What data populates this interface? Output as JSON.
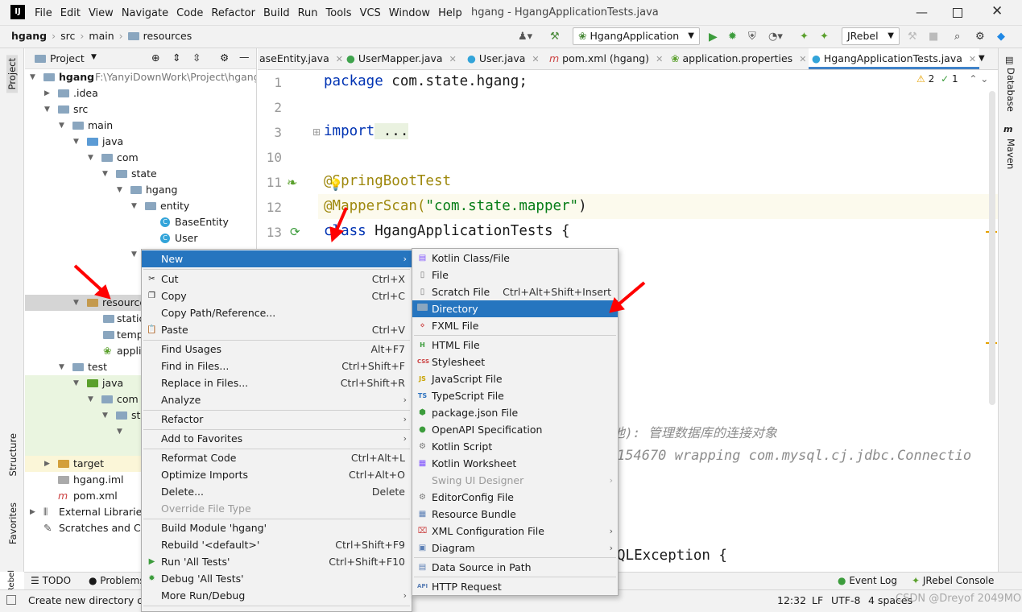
{
  "menubar": {
    "items": [
      "File",
      "Edit",
      "View",
      "Navigate",
      "Code",
      "Refactor",
      "Build",
      "Run",
      "Tools",
      "VCS",
      "Window",
      "Help"
    ],
    "title": "hgang - HgangApplicationTests.java"
  },
  "nav": {
    "crumbs": [
      "hgang",
      "src",
      "main",
      "resources"
    ],
    "run_config": "HgangApplication",
    "jrebel": "JRebel"
  },
  "left_tabs": [
    "Project",
    "Structure",
    "Favorites",
    "JRebel"
  ],
  "right_tabs": [
    "Database",
    "Maven"
  ],
  "project": {
    "header": "Project",
    "root": {
      "name": "hgang",
      "path": "F:\\YanyiDownWork\\Project\\hgang"
    },
    "rows": [
      ".idea",
      "src",
      "main",
      "java",
      "com",
      "state",
      "hgang",
      "entity",
      "BaseEntity",
      "User",
      "resource",
      "static",
      "temp",
      "appli",
      "test",
      "java",
      "com",
      "sta",
      "target",
      "hgang.iml",
      "pom.xml",
      "External Libraries",
      "Scratches and Co"
    ]
  },
  "tabs": [
    "aseEntity.java",
    "UserMapper.java",
    "User.java",
    "pom.xml (hgang)",
    "application.properties",
    "HgangApplicationTests.java"
  ],
  "editor": {
    "line_numbers": [
      "1",
      "2",
      "3",
      "10",
      "11",
      "12",
      "13"
    ],
    "code": {
      "l1a": "package",
      "l1b": " com.state.hgang;",
      "l3a": "import",
      "l3b": " ...",
      "l11": "@SpringBootTest",
      "l12a": "@MapperScan(",
      "l12b": "\"com.state.mapper\"",
      "l12c": ")",
      "l13a": "class",
      "l13b": " HgangApplicationTests {",
      "peek1": "池): 管理数据库的连接对象",
      "peek2": "154670 wrapping com.mysql.cj.jdbc.Connectio",
      "peek3": "QLException {"
    },
    "inspections": {
      "warnings": "2",
      "checks": "1"
    }
  },
  "context_menu": {
    "items": [
      {
        "label": "New",
        "shortcut": "",
        "sub": true
      },
      {
        "label": "Cut",
        "shortcut": "Ctrl+X"
      },
      {
        "label": "Copy",
        "shortcut": "Ctrl+C"
      },
      {
        "label": "Copy Path/Reference...",
        "shortcut": ""
      },
      {
        "label": "Paste",
        "shortcut": "Ctrl+V"
      },
      {
        "label": "Find Usages",
        "shortcut": "Alt+F7"
      },
      {
        "label": "Find in Files...",
        "shortcut": "Ctrl+Shift+F"
      },
      {
        "label": "Replace in Files...",
        "shortcut": "Ctrl+Shift+R"
      },
      {
        "label": "Analyze",
        "shortcut": "",
        "sub": true
      },
      {
        "label": "Refactor",
        "shortcut": "",
        "sub": true
      },
      {
        "label": "Add to Favorites",
        "shortcut": "",
        "sub": true
      },
      {
        "label": "Reformat Code",
        "shortcut": "Ctrl+Alt+L"
      },
      {
        "label": "Optimize Imports",
        "shortcut": "Ctrl+Alt+O"
      },
      {
        "label": "Delete...",
        "shortcut": "Delete"
      },
      {
        "label": "Override File Type",
        "shortcut": ""
      },
      {
        "label": "Build Module 'hgang'",
        "shortcut": ""
      },
      {
        "label": "Rebuild '<default>'",
        "shortcut": "Ctrl+Shift+F9"
      },
      {
        "label": "Run 'All Tests'",
        "shortcut": "Ctrl+Shift+F10"
      },
      {
        "label": "Debug 'All Tests'",
        "shortcut": ""
      },
      {
        "label": "More Run/Debug",
        "shortcut": "",
        "sub": true
      }
    ]
  },
  "new_submenu": {
    "items": [
      {
        "label": "Kotlin Class/File",
        "shortcut": ""
      },
      {
        "label": "File",
        "shortcut": ""
      },
      {
        "label": "Scratch File",
        "shortcut": "Ctrl+Alt+Shift+Insert"
      },
      {
        "label": "Directory",
        "shortcut": ""
      },
      {
        "label": "FXML File",
        "shortcut": ""
      },
      {
        "label": "HTML File",
        "shortcut": ""
      },
      {
        "label": "Stylesheet",
        "shortcut": ""
      },
      {
        "label": "JavaScript File",
        "shortcut": ""
      },
      {
        "label": "TypeScript File",
        "shortcut": ""
      },
      {
        "label": "package.json File",
        "shortcut": ""
      },
      {
        "label": "OpenAPI Specification",
        "shortcut": ""
      },
      {
        "label": "Kotlin Script",
        "shortcut": ""
      },
      {
        "label": "Kotlin Worksheet",
        "shortcut": ""
      },
      {
        "label": "Swing UI Designer",
        "shortcut": "",
        "sub": true
      },
      {
        "label": "EditorConfig File",
        "shortcut": ""
      },
      {
        "label": "Resource Bundle",
        "shortcut": ""
      },
      {
        "label": "XML Configuration File",
        "shortcut": "",
        "sub": true
      },
      {
        "label": "Diagram",
        "shortcut": "",
        "sub": true
      },
      {
        "label": "Data Source in Path",
        "shortcut": ""
      },
      {
        "label": "HTTP Request",
        "shortcut": ""
      }
    ]
  },
  "bottom": {
    "todo": "TODO",
    "problems": "Problems",
    "event_log": "Event Log",
    "jrebel_console": "JRebel Console"
  },
  "status": {
    "message": "Create new directory or",
    "position": "12:32",
    "line_sep": "LF",
    "encoding": "UTF-8",
    "indent": "4 spaces",
    "watermark": "CSDN @Dreyof 2049MO"
  },
  "colors": {
    "accent": "#2675bf",
    "arrow": "#ff0000"
  }
}
